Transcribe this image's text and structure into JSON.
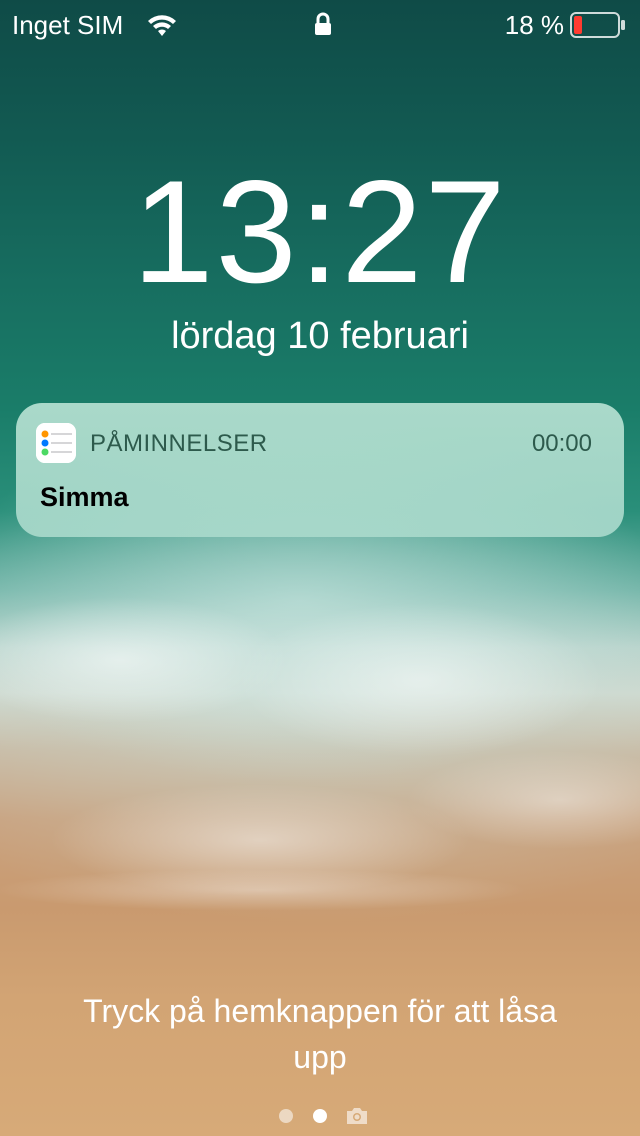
{
  "status_bar": {
    "carrier": "Inget SIM",
    "battery_percent_label": "18 %",
    "battery_level": 0.18,
    "battery_color": "#ff3b30",
    "wifi_icon": "wifi-icon",
    "lock_icon": "lock-icon"
  },
  "lock_screen": {
    "time": "13:27",
    "date": "lördag 10 februari",
    "unlock_hint": "Tryck på hemknappen för att låsa upp"
  },
  "notification": {
    "app_icon": "reminders-app-icon",
    "app_name": "PÅMINNELSER",
    "time": "00:00",
    "title": "Simma"
  },
  "page_indicator": {
    "pages": 2,
    "current_page": 2,
    "camera_icon": "camera-icon"
  }
}
